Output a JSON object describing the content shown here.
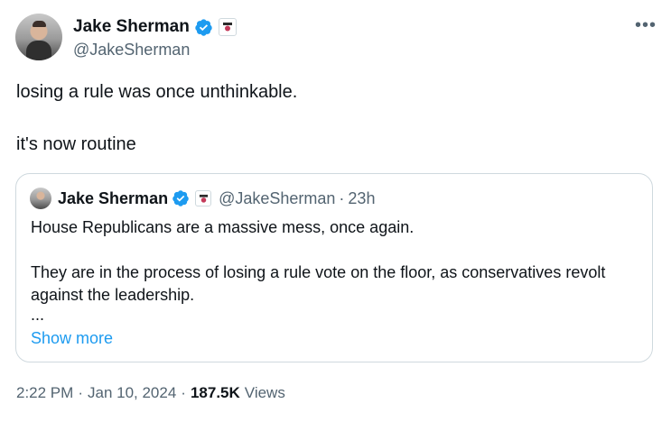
{
  "author": {
    "name": "Jake Sherman",
    "handle": "@JakeSherman",
    "more_label": "•••"
  },
  "tweet": {
    "line1": "losing a rule was once unthinkable.",
    "line2": "it's now routine"
  },
  "quoted": {
    "name": "Jake Sherman",
    "handle": "@JakeSherman",
    "dot": "·",
    "time": "23h",
    "para1": "House Republicans are a massive mess, once again.",
    "para2": "They are in the process of losing a rule vote on the floor, as conservatives revolt against the leadership.",
    "ellipsis": "...",
    "show_more": "Show more"
  },
  "meta": {
    "time": "2:22 PM",
    "dot1": "·",
    "date": "Jan 10, 2024",
    "dot2": "·",
    "views_count": "187.5K",
    "views_label": "Views"
  },
  "colors": {
    "verified": "#1d9bf0",
    "link": "#1d9bf0",
    "secondary_text": "#536471",
    "border": "#cfd9de"
  },
  "icons": {
    "verified": "verified-badge-icon",
    "affiliate": "affiliate-badge-icon",
    "more": "more-options-icon"
  }
}
